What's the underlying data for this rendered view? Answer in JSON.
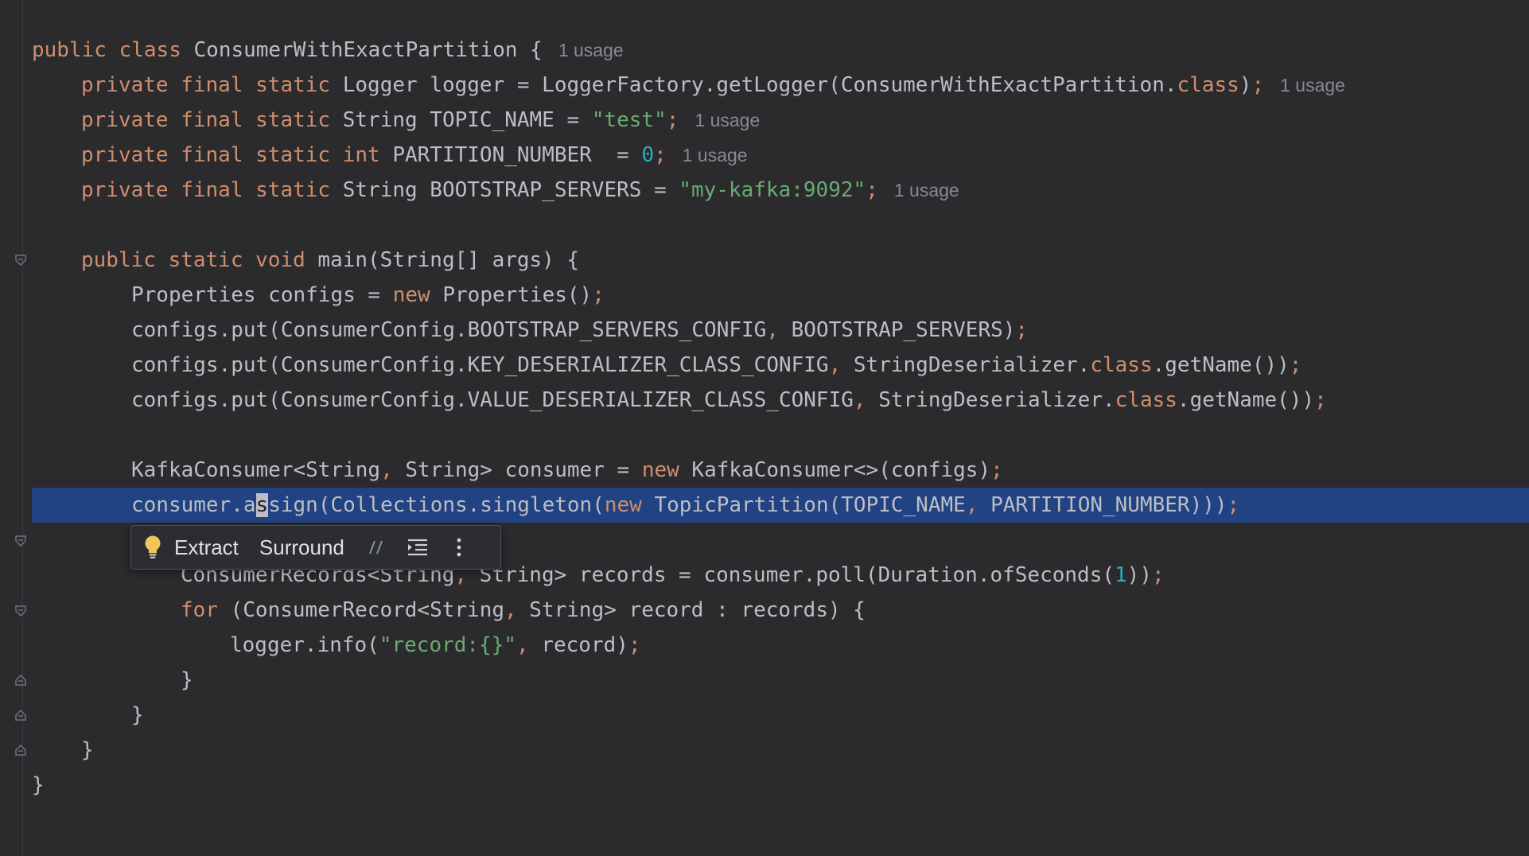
{
  "code": {
    "class_decl": {
      "kw1": "public",
      "kw2": "class",
      "name": "ConsumerWithExactPartition",
      "brace": " {",
      "hint": "1 usage"
    },
    "logger": {
      "mods": "private final static",
      "type": " Logger logger = LoggerFactory.getLogger(ConsumerWithExactPartition.",
      "kw": "class",
      "rest": ")",
      "semi": ";",
      "hint": "1 usage"
    },
    "topic": {
      "mods": "private final static",
      "decl": " String TOPIC_NAME = ",
      "value": "\"test\"",
      "semi": ";",
      "hint": "1 usage"
    },
    "partition": {
      "mods": "private final static",
      "kw": " int",
      "decl": " PARTITION_NUMBER  = ",
      "value": "0",
      "semi": ";",
      "hint": "1 usage"
    },
    "bootstrap": {
      "mods": "private final static",
      "decl": " String BOOTSTRAP_SERVERS = ",
      "value": "\"my-kafka:9092\"",
      "semi": ";",
      "hint": "1 usage"
    },
    "main_decl": {
      "mods": "public static void",
      "rest": " main(String[] args) {"
    },
    "props": {
      "a": "Properties configs = ",
      "kw": "new",
      "b": " Properties()",
      "semi": ";"
    },
    "put1": {
      "a": "configs.put(ConsumerConfig.BOOTSTRAP_SERVERS_CONFIG",
      "comma": ",",
      "b": " BOOTSTRAP_SERVERS)",
      "semi": ";"
    },
    "put2": {
      "a": "configs.put(ConsumerConfig.KEY_DESERIALIZER_CLASS_CONFIG",
      "comma": ",",
      "b": " StringDeserializer.",
      "kw": "class",
      "c": ".getName())",
      "semi": ";"
    },
    "put3": {
      "a": "configs.put(ConsumerConfig.VALUE_DESERIALIZER_CLASS_CONFIG",
      "comma": ",",
      "b": " StringDeserializer.",
      "kw": "class",
      "c": ".getName())",
      "semi": ";"
    },
    "consumer_decl": {
      "a": "KafkaConsumer<String",
      "comma": ",",
      "b": " String> consumer = ",
      "kw": "new",
      "c": " KafkaConsumer<>(configs)",
      "semi": ";"
    },
    "assign": {
      "a": "consumer.a",
      "caret_char": "s",
      "b": "sign(Collections.singleton(",
      "kw": "new",
      "c": " TopicPartition(TOPIC_NAME",
      "comma": ",",
      "d": " PARTITION_NUMBER)))",
      "semi": ";"
    },
    "records": {
      "a": "ConsumerRecords<String",
      "comma": ",",
      "b": " String> records = consumer.poll(Duration.ofSeconds(",
      "num": "1",
      "c": "))",
      "semi": ";"
    },
    "for_loop": {
      "kw": "for",
      "a": " (ConsumerRecord<String",
      "comma": ",",
      "b": " String> record : records) {"
    },
    "log": {
      "a": "logger.info(",
      "str": "\"record:{}\"",
      "comma": ",",
      "b": " record)",
      "semi": ";"
    },
    "close1": "}",
    "close2": "}",
    "close3": "}",
    "close4": "}"
  },
  "intention_popup": {
    "bulb_icon": "lightbulb-icon",
    "extract_label": "Extract",
    "surround_label": "Surround",
    "comment_icon": "comment-icon",
    "reformat_icon": "reformat-icon",
    "more_icon": "more-vertical-icon"
  },
  "colors": {
    "background": "#2b2b2d",
    "selection": "#214283",
    "keyword": "#cf8e6d",
    "string": "#6aab73",
    "number": "#2aacb8",
    "hint": "#868a91"
  }
}
